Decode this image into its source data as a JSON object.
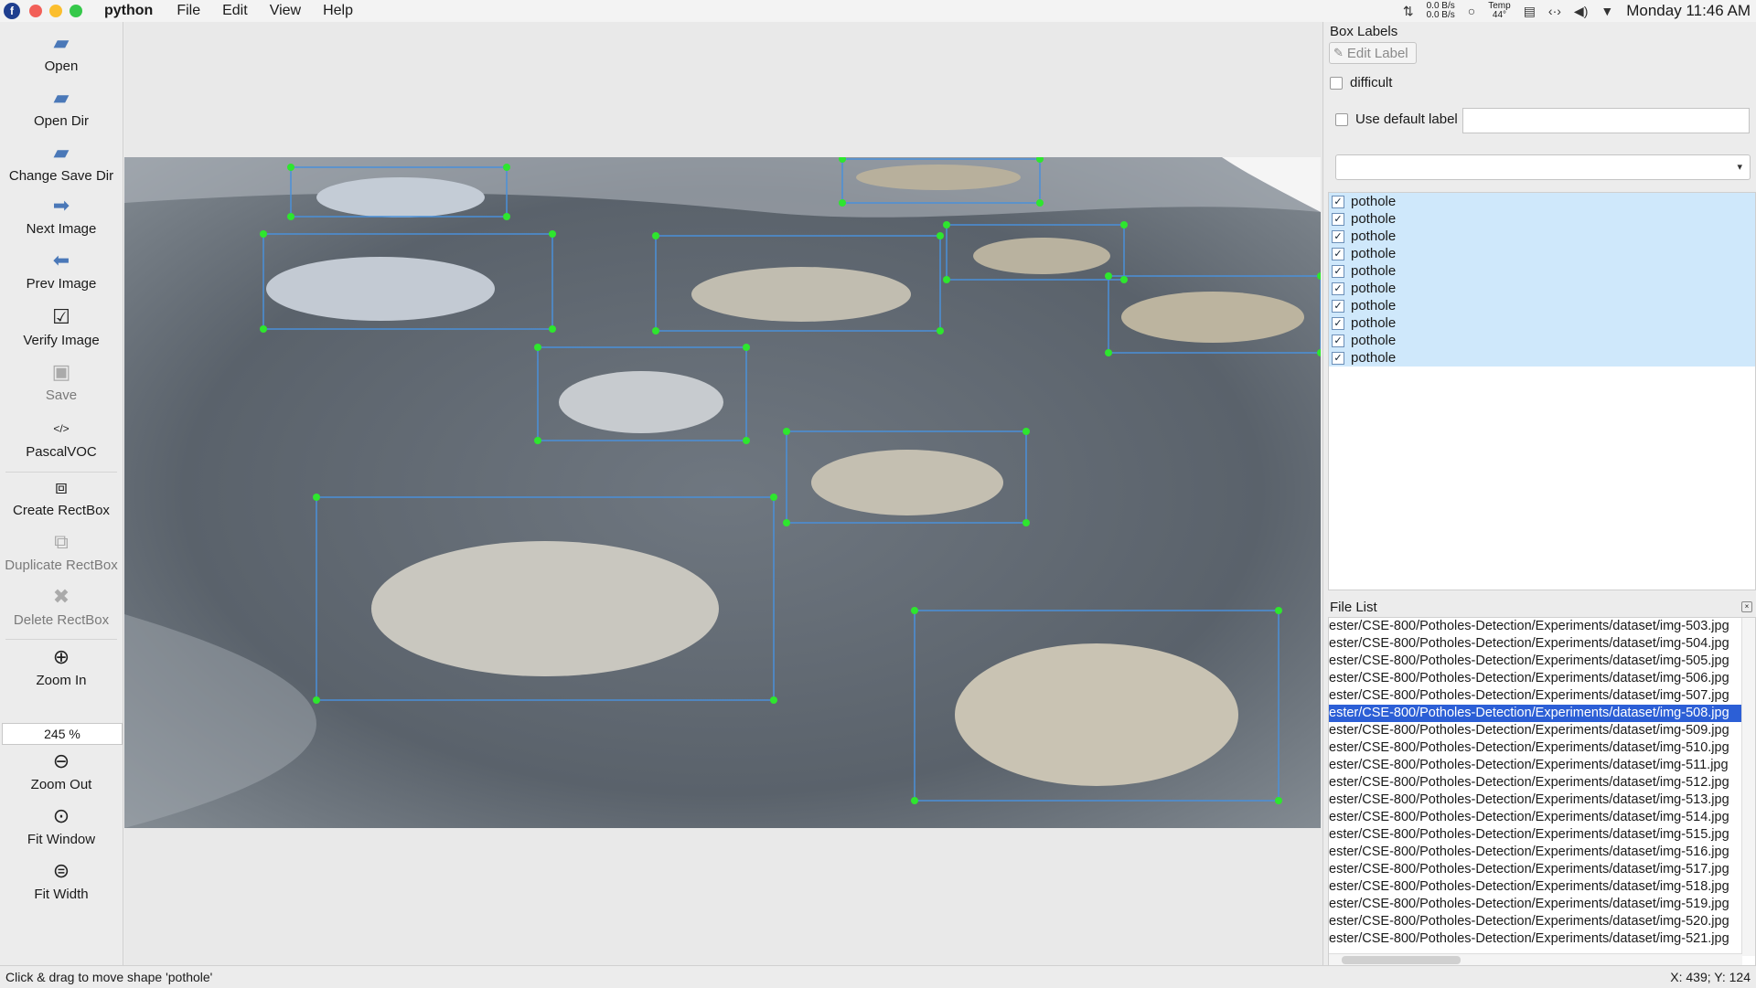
{
  "menubar": {
    "app_name": "python",
    "menus": [
      "File",
      "Edit",
      "View",
      "Help"
    ],
    "net_down": "0.0 B/s",
    "net_up": "0.0 B/s",
    "temp_label": "Temp",
    "temp_value": "44°",
    "clock": "Monday 11:46 AM"
  },
  "toolbar": {
    "open": "Open",
    "open_dir": "Open Dir",
    "change_save_dir": "Change Save Dir",
    "next_image": "Next Image",
    "prev_image": "Prev Image",
    "verify_image": "Verify Image",
    "save": "Save",
    "format": "PascalVOC",
    "create_rectbox": "Create RectBox",
    "duplicate_rectbox": "Duplicate RectBox",
    "delete_rectbox": "Delete RectBox",
    "zoom_in": "Zoom In",
    "zoom_value": "245 %",
    "zoom_out": "Zoom Out",
    "fit_window": "Fit Window",
    "fit_width": "Fit Width"
  },
  "box_labels": {
    "title": "Box Labels",
    "edit_label": "Edit Label",
    "difficult": "difficult",
    "use_default_label": "Use default label",
    "default_label_value": "",
    "labels": [
      "pothole",
      "pothole",
      "pothole",
      "pothole",
      "pothole",
      "pothole",
      "pothole",
      "pothole",
      "pothole",
      "pothole"
    ]
  },
  "file_list": {
    "title": "File List",
    "selected_index": 5,
    "files": [
      "ester/CSE-800/Potholes-Detection/Experiments/dataset/img-503.jpg",
      "ester/CSE-800/Potholes-Detection/Experiments/dataset/img-504.jpg",
      "ester/CSE-800/Potholes-Detection/Experiments/dataset/img-505.jpg",
      "ester/CSE-800/Potholes-Detection/Experiments/dataset/img-506.jpg",
      "ester/CSE-800/Potholes-Detection/Experiments/dataset/img-507.jpg",
      "ester/CSE-800/Potholes-Detection/Experiments/dataset/img-508.jpg",
      "ester/CSE-800/Potholes-Detection/Experiments/dataset/img-509.jpg",
      "ester/CSE-800/Potholes-Detection/Experiments/dataset/img-510.jpg",
      "ester/CSE-800/Potholes-Detection/Experiments/dataset/img-511.jpg",
      "ester/CSE-800/Potholes-Detection/Experiments/dataset/img-512.jpg",
      "ester/CSE-800/Potholes-Detection/Experiments/dataset/img-513.jpg",
      "ester/CSE-800/Potholes-Detection/Experiments/dataset/img-514.jpg",
      "ester/CSE-800/Potholes-Detection/Experiments/dataset/img-515.jpg",
      "ester/CSE-800/Potholes-Detection/Experiments/dataset/img-516.jpg",
      "ester/CSE-800/Potholes-Detection/Experiments/dataset/img-517.jpg",
      "ester/CSE-800/Potholes-Detection/Experiments/dataset/img-518.jpg",
      "ester/CSE-800/Potholes-Detection/Experiments/dataset/img-519.jpg",
      "ester/CSE-800/Potholes-Detection/Experiments/dataset/img-520.jpg",
      "ester/CSE-800/Potholes-Detection/Experiments/dataset/img-521.jpg"
    ]
  },
  "status": {
    "message": "Click & drag to move shape 'pothole'",
    "coords": "X: 439; Y: 124"
  },
  "colors": {
    "box_stroke": "#4a90d9",
    "vertex": "#2ee62e",
    "selection": "#2c5fd6",
    "label_highlight": "#cfe8fb"
  }
}
